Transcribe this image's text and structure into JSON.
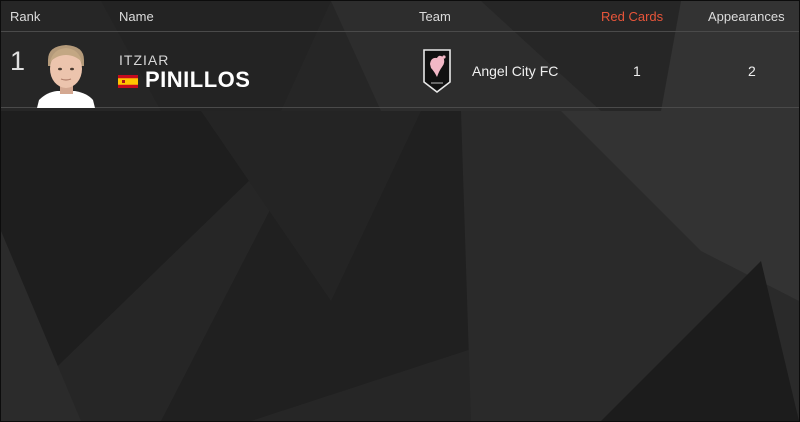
{
  "header": {
    "rank": "Rank",
    "name": "Name",
    "team": "Team",
    "red_cards": "Red Cards",
    "appearances": "Appearances"
  },
  "colors": {
    "accent": "#e8553a",
    "background": "#262626",
    "text": "#e8e8e8",
    "divider": "#4a4a4a"
  },
  "rows": [
    {
      "rank": "1",
      "first_name": "ITZIAR",
      "last_name": "PINILLOS",
      "flag": "spain-flag-icon",
      "team": "Angel City FC",
      "team_crest": "angel-city-crest-icon",
      "red_cards": "1",
      "appearances": "2"
    }
  ]
}
